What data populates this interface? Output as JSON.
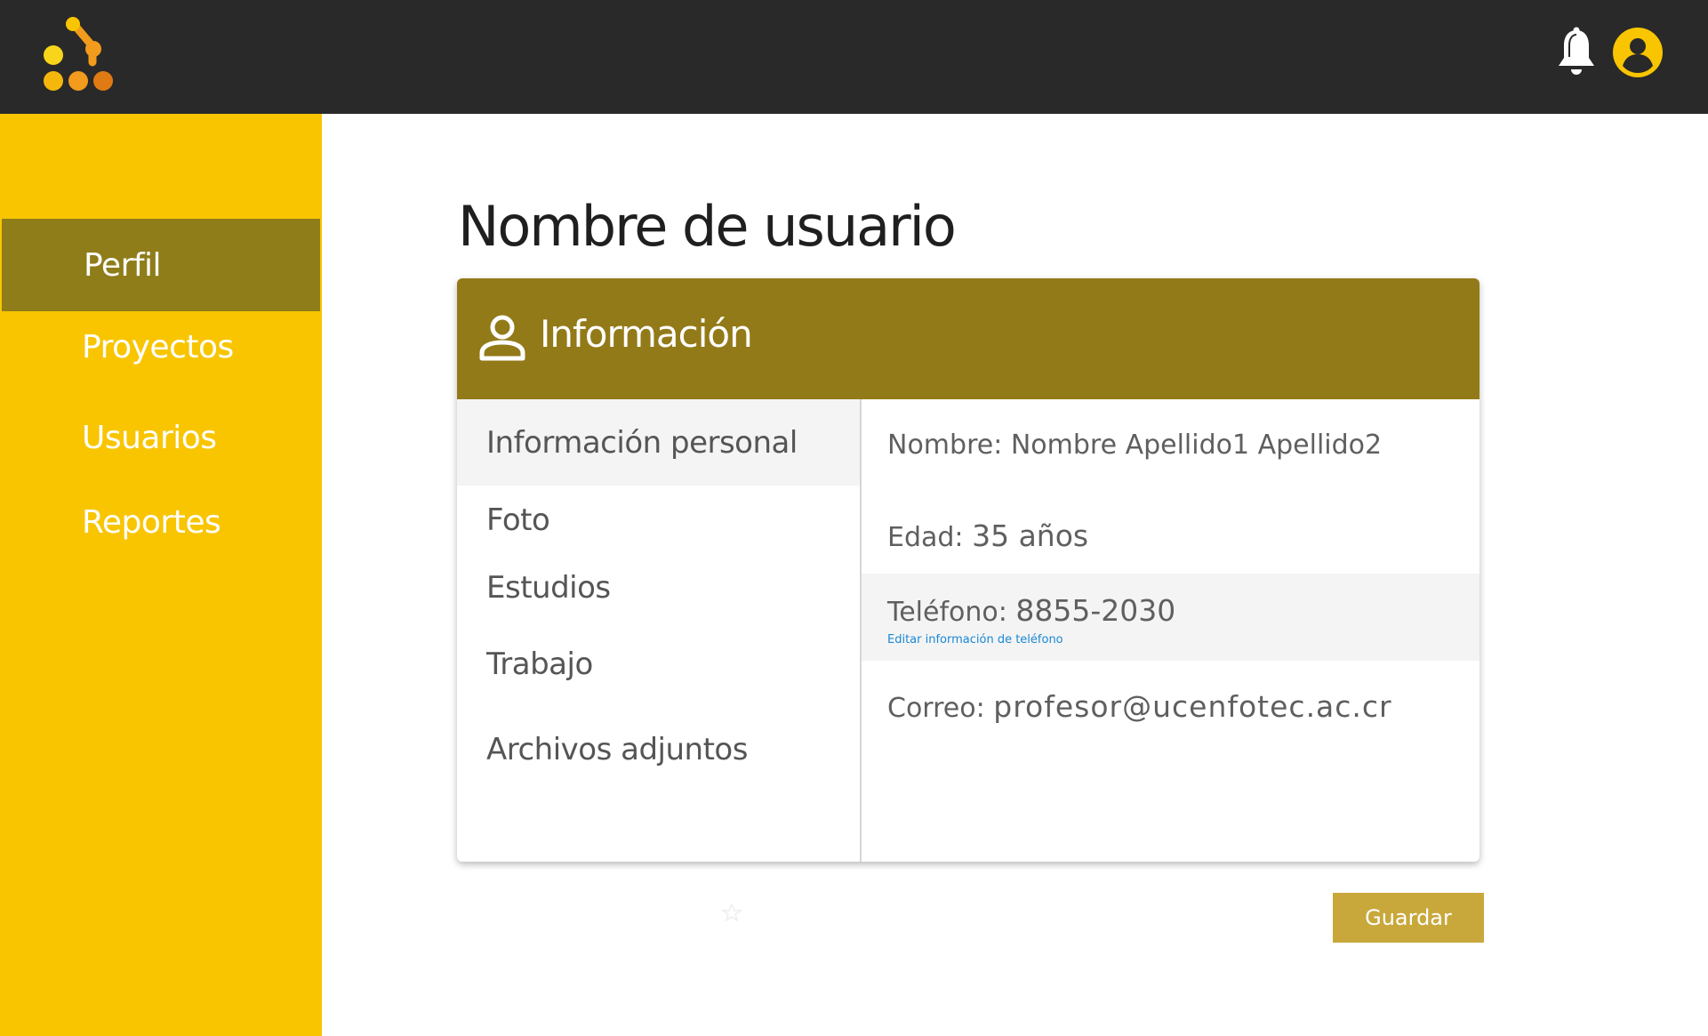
{
  "header": {
    "logo_icon": "dots-network-logo",
    "notification_icon": "bell-icon",
    "account_icon": "user-circle-icon",
    "colors": {
      "background": "#292929",
      "icon": "#ffffff",
      "account_icon": "#f8c500"
    }
  },
  "sidebar": {
    "background": "#f8c500",
    "active_background": "#8f7d1a",
    "items": [
      {
        "label": "Perfil",
        "active": true
      },
      {
        "label": "Proyectos",
        "active": false
      },
      {
        "label": "Usuarios",
        "active": false
      },
      {
        "label": "Reportes",
        "active": false
      }
    ]
  },
  "main": {
    "title": "Nombre de usuario",
    "card": {
      "header_title": "Información",
      "header_icon": "person-icon",
      "header_color": "#937a18",
      "menu": [
        {
          "label": "Información personal",
          "active": true
        },
        {
          "label": "Foto",
          "active": false
        },
        {
          "label": "Estudios",
          "active": false
        },
        {
          "label": "Trabajo",
          "active": false
        },
        {
          "label": "Archivos adjuntos",
          "active": false
        }
      ],
      "details": {
        "name": "Nombre: Nombre Apellido1  Apellido2",
        "age_label": "Edad:",
        "age_value": "35 años",
        "phone_label": "Teléfono:",
        "phone_value": "8855-2030",
        "phone_edit_link": "Editar información de teléfono",
        "email_label": "Correo:",
        "email_value": "profesor@ucenfotec.ac.cr"
      }
    },
    "save_button": "Guardar",
    "save_color": "#c8a83b"
  }
}
